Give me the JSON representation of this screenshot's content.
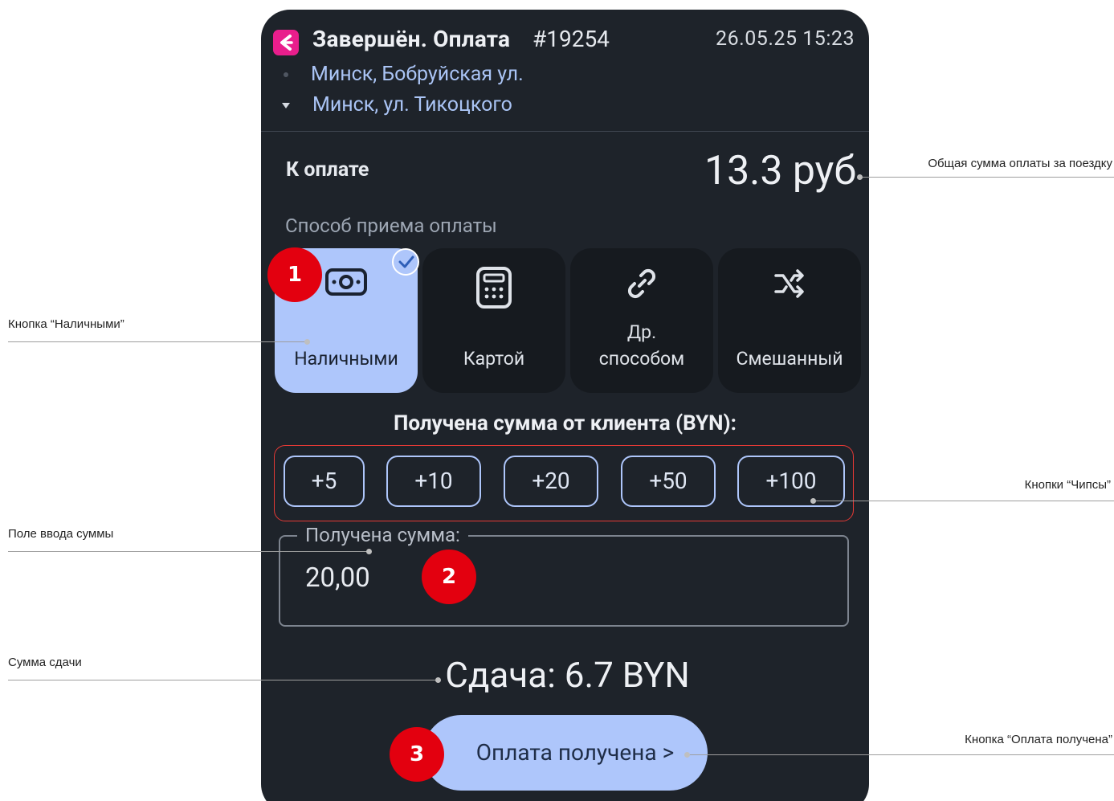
{
  "header": {
    "title": "Завершён. Оплата",
    "order_number": "#19254",
    "datetime": "26.05.25 15:23",
    "route_from": "Минск, Бобруйская ул.",
    "route_to": "Минск, ул. Тикоцкого"
  },
  "payment": {
    "to_pay_label": "К оплате",
    "to_pay_amount": "13.3 руб",
    "method_title": "Способ приема оплаты",
    "methods": [
      {
        "label": "Наличными",
        "icon": "cash-icon",
        "selected": true
      },
      {
        "label": "Картой",
        "icon": "card-terminal-icon",
        "selected": false
      },
      {
        "label_line1": "Др.",
        "label_line2": "способом",
        "icon": "link-icon",
        "selected": false
      },
      {
        "label": "Смешанный",
        "icon": "shuffle-icon",
        "selected": false
      }
    ],
    "received_title": "Получена сумма от клиента (BYN):",
    "chips": [
      "+5",
      "+10",
      "+20",
      "+50",
      "+100"
    ],
    "input_label": "Получена сумма:",
    "input_value": "20,00",
    "change_text": "Сдача: 6.7 BYN",
    "confirm_button": "Оплата получена >"
  },
  "annotations": {
    "total_amount": "Общая сумма оплаты за поездку",
    "cash_button": "Кнопка “Наличными”",
    "chips": "Кнопки “Чипсы”",
    "amount_input": "Поле ввода суммы",
    "change_amount": "Сумма сдачи",
    "confirm_button": "Кнопка “Оплата получена”",
    "badges": [
      "1",
      "2",
      "3"
    ]
  },
  "colors": {
    "screen_bg": "#1e232a",
    "accent": "#aec6fb",
    "logo": "#e91e8c",
    "badge": "#e3000f",
    "chips_frame": "#e53935"
  }
}
